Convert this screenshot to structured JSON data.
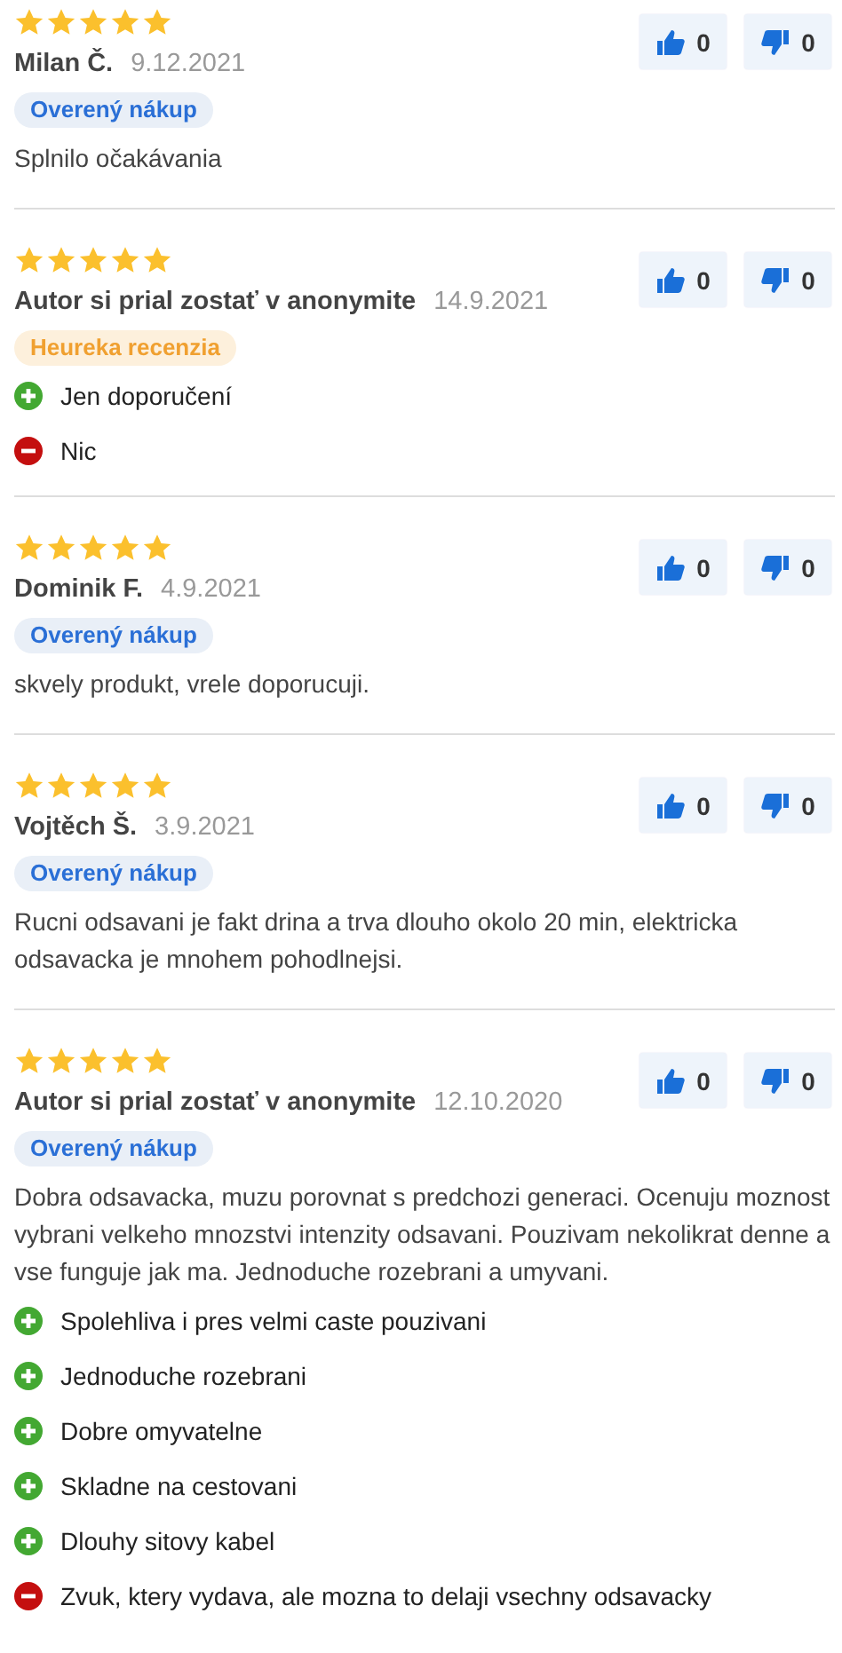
{
  "reviews": [
    {
      "stars": 5,
      "author": "Milan Č.",
      "date": "9.12.2021",
      "badge": {
        "kind": "verified",
        "label": "Overený nákup"
      },
      "text": "Splnilo očakávania",
      "likes": "0",
      "dislikes": "0"
    },
    {
      "stars": 5,
      "author": "Autor si prial zostať v anonymite",
      "date": "14.9.2021",
      "badge": {
        "kind": "heureka",
        "label": "Heureka recenzia"
      },
      "points": [
        {
          "kind": "pro",
          "text": "Jen doporučení"
        },
        {
          "kind": "con",
          "text": "Nic"
        }
      ],
      "likes": "0",
      "dislikes": "0"
    },
    {
      "stars": 5,
      "author": "Dominik F.",
      "date": "4.9.2021",
      "badge": {
        "kind": "verified",
        "label": "Overený nákup"
      },
      "text": "skvely produkt, vrele doporucuji.",
      "likes": "0",
      "dislikes": "0"
    },
    {
      "stars": 5,
      "author": "Vojtěch Š.",
      "date": "3.9.2021",
      "badge": {
        "kind": "verified",
        "label": "Overený nákup"
      },
      "text": "Rucni odsavani je fakt drina a trva dlouho okolo 20 min, elektricka odsavacka je mnohem pohodlnejsi.",
      "likes": "0",
      "dislikes": "0"
    },
    {
      "stars": 5,
      "author": "Autor si prial zostať v anonymite",
      "date": "12.10.2020",
      "badge": {
        "kind": "verified",
        "label": "Overený nákup"
      },
      "text": "Dobra odsavacka, muzu porovnat s predchozi generaci. Ocenuju moznost vybrani velkeho mnozstvi intenzity odsavani. Pouzivam nekolikrat denne a vse funguje jak ma. Jednoduche rozebrani a umyvani.",
      "points": [
        {
          "kind": "pro",
          "text": "Spolehliva i pres velmi caste pouzivani"
        },
        {
          "kind": "pro",
          "text": "Jednoduche rozebrani"
        },
        {
          "kind": "pro",
          "text": "Dobre omyvatelne"
        },
        {
          "kind": "pro",
          "text": "Skladne na cestovani"
        },
        {
          "kind": "pro",
          "text": "Dlouhy sitovy kabel"
        },
        {
          "kind": "con",
          "text": "Zvuk, ktery vydava, ale mozna to delaji vsechny odsavacky"
        }
      ],
      "likes": "0",
      "dislikes": "0"
    }
  ]
}
